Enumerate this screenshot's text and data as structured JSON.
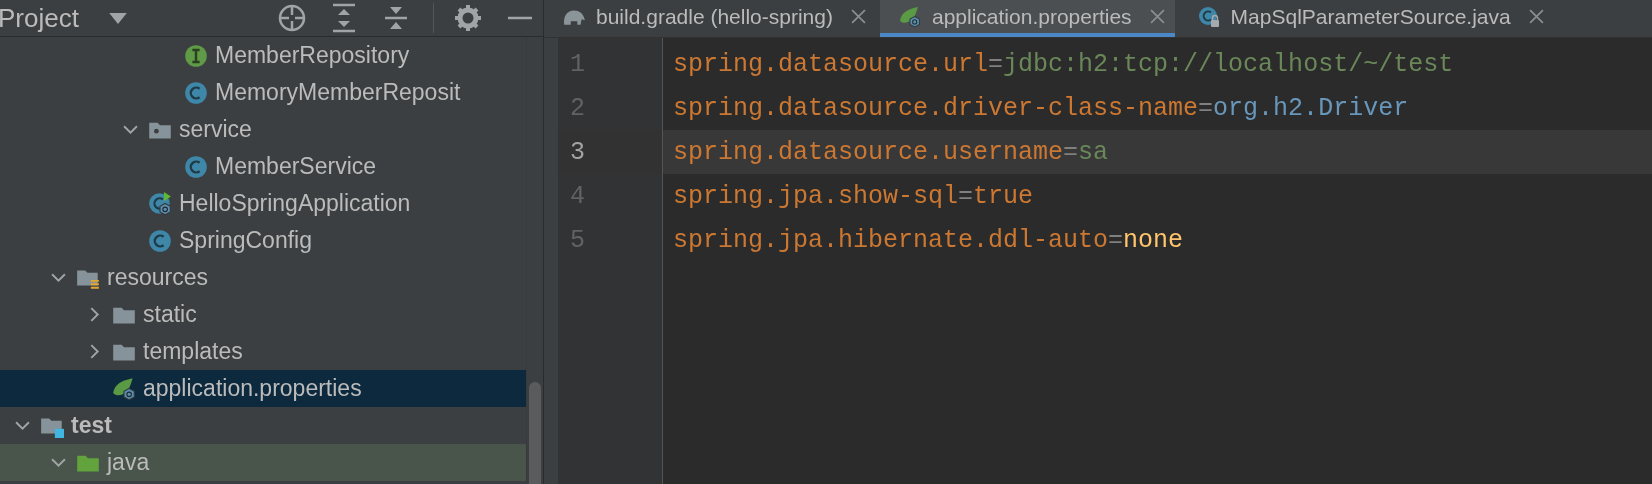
{
  "project_panel": {
    "title": "Project",
    "tree": [
      {
        "children": [
          {
            "children": [
              {
                "children": [
                  {
                    "children": [
                      {
                        "label": "MemberRepository",
                        "kind": "interface",
                        "selected": false
                      },
                      {
                        "label": "MemoryMemberReposit",
                        "kind": "class",
                        "selected": false
                      }
                    ]
                  },
                  {
                    "label": "service",
                    "kind": "package",
                    "expanded": true,
                    "selected": false,
                    "children": [
                      {
                        "label": "MemberService",
                        "kind": "class",
                        "selected": false
                      }
                    ]
                  },
                  {
                    "label": "HelloSpringApplication",
                    "kind": "spring-app",
                    "selected": false
                  },
                  {
                    "label": "SpringConfig",
                    "kind": "class",
                    "selected": false
                  }
                ]
              }
            ]
          },
          {
            "label": "resources",
            "kind": "resources-folder",
            "expanded": true,
            "selected": false,
            "children": [
              {
                "label": "static",
                "kind": "folder",
                "expanded": false,
                "selected": false
              },
              {
                "label": "templates",
                "kind": "folder",
                "expanded": false,
                "selected": false
              },
              {
                "label": "application.properties",
                "kind": "properties",
                "selected": true
              }
            ]
          }
        ]
      },
      {
        "label": "test",
        "kind": "test-folder",
        "expanded": true,
        "selected": false,
        "children": [
          {
            "label": "java",
            "kind": "test-sources",
            "expanded": true,
            "selected": false
          }
        ]
      }
    ]
  },
  "tabs": [
    {
      "label": "build.gradle (hello-spring)",
      "kind": "gradle",
      "selected": false
    },
    {
      "label": "application.properties",
      "kind": "properties",
      "selected": true
    },
    {
      "label": "MapSqlParameterSource.java",
      "kind": "locked-class",
      "selected": false
    }
  ],
  "editor": {
    "lines": [
      {
        "number": "1",
        "key": "spring.datasource.url",
        "sep": "=",
        "value": "jdbc:h2:tcp://localhost/~/test",
        "kind": "string",
        "current": false
      },
      {
        "number": "2",
        "key": "spring.datasource.driver-class-name",
        "sep": "=",
        "value": "org.h2.Driver",
        "kind": "class",
        "current": false
      },
      {
        "number": "3",
        "key": "spring.datasource.username",
        "sep": "=",
        "value": "sa",
        "kind": "string",
        "current": true
      },
      {
        "number": "4",
        "key": "spring.jpa.show-sql",
        "sep": "=",
        "value": "true",
        "kind": "keyword",
        "current": false
      },
      {
        "number": "5",
        "key": "spring.jpa.hibernate.ddl-auto",
        "sep": "=",
        "value": "none",
        "kind": "enum",
        "current": false
      }
    ]
  }
}
